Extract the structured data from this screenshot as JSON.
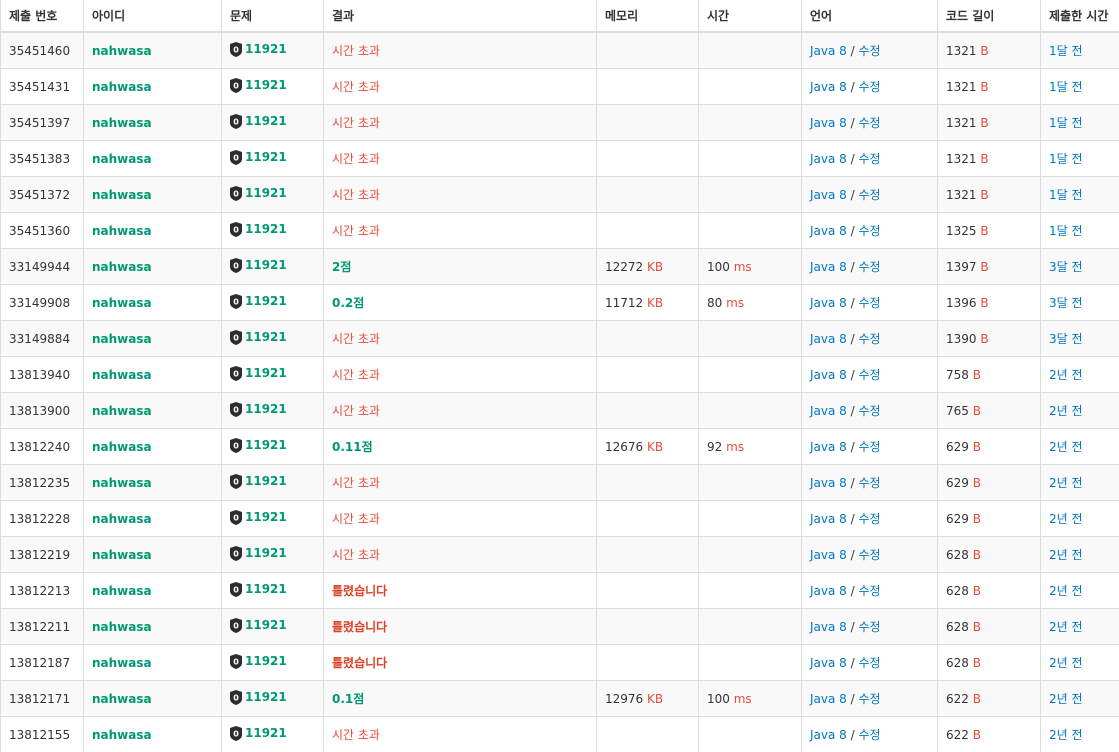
{
  "columns": {
    "id": "제출 번호",
    "user": "아이디",
    "problem": "문제",
    "result": "결과",
    "memory": "메모리",
    "time": "시간",
    "lang": "언어",
    "length": "코드 길이",
    "submitted": "제출한 시간"
  },
  "units": {
    "memory": "KB",
    "time": "ms",
    "length": "B"
  },
  "colors": {
    "user": "#009874",
    "problem": "#009874",
    "time_limit": "#e74c3c",
    "wrong": "#dd4124",
    "partial": "#009874",
    "link": "#0076c0"
  },
  "rows": [
    {
      "id": "35451460",
      "user": "nahwasa",
      "problem": "11921",
      "result": "시간 초과",
      "result_type": "tle",
      "memory": "",
      "time": "",
      "lang": "Java 8",
      "edit": "수정",
      "length": "1321",
      "submitted": "1달 전"
    },
    {
      "id": "35451431",
      "user": "nahwasa",
      "problem": "11921",
      "result": "시간 초과",
      "result_type": "tle",
      "memory": "",
      "time": "",
      "lang": "Java 8",
      "edit": "수정",
      "length": "1321",
      "submitted": "1달 전"
    },
    {
      "id": "35451397",
      "user": "nahwasa",
      "problem": "11921",
      "result": "시간 초과",
      "result_type": "tle",
      "memory": "",
      "time": "",
      "lang": "Java 8",
      "edit": "수정",
      "length": "1321",
      "submitted": "1달 전"
    },
    {
      "id": "35451383",
      "user": "nahwasa",
      "problem": "11921",
      "result": "시간 초과",
      "result_type": "tle",
      "memory": "",
      "time": "",
      "lang": "Java 8",
      "edit": "수정",
      "length": "1321",
      "submitted": "1달 전"
    },
    {
      "id": "35451372",
      "user": "nahwasa",
      "problem": "11921",
      "result": "시간 초과",
      "result_type": "tle",
      "memory": "",
      "time": "",
      "lang": "Java 8",
      "edit": "수정",
      "length": "1321",
      "submitted": "1달 전"
    },
    {
      "id": "35451360",
      "user": "nahwasa",
      "problem": "11921",
      "result": "시간 초과",
      "result_type": "tle",
      "memory": "",
      "time": "",
      "lang": "Java 8",
      "edit": "수정",
      "length": "1325",
      "submitted": "1달 전"
    },
    {
      "id": "33149944",
      "user": "nahwasa",
      "problem": "11921",
      "result": "2점",
      "result_type": "partial",
      "memory": "12272",
      "time": "100",
      "lang": "Java 8",
      "edit": "수정",
      "length": "1397",
      "submitted": "3달 전"
    },
    {
      "id": "33149908",
      "user": "nahwasa",
      "problem": "11921",
      "result": "0.2점",
      "result_type": "partial",
      "memory": "11712",
      "time": "80",
      "lang": "Java 8",
      "edit": "수정",
      "length": "1396",
      "submitted": "3달 전"
    },
    {
      "id": "33149884",
      "user": "nahwasa",
      "problem": "11921",
      "result": "시간 초과",
      "result_type": "tle",
      "memory": "",
      "time": "",
      "lang": "Java 8",
      "edit": "수정",
      "length": "1390",
      "submitted": "3달 전"
    },
    {
      "id": "13813940",
      "user": "nahwasa",
      "problem": "11921",
      "result": "시간 초과",
      "result_type": "tle",
      "memory": "",
      "time": "",
      "lang": "Java 8",
      "edit": "수정",
      "length": "758",
      "submitted": "2년 전"
    },
    {
      "id": "13813900",
      "user": "nahwasa",
      "problem": "11921",
      "result": "시간 초과",
      "result_type": "tle",
      "memory": "",
      "time": "",
      "lang": "Java 8",
      "edit": "수정",
      "length": "765",
      "submitted": "2년 전"
    },
    {
      "id": "13812240",
      "user": "nahwasa",
      "problem": "11921",
      "result": "0.11점",
      "result_type": "partial",
      "memory": "12676",
      "time": "92",
      "lang": "Java 8",
      "edit": "수정",
      "length": "629",
      "submitted": "2년 전"
    },
    {
      "id": "13812235",
      "user": "nahwasa",
      "problem": "11921",
      "result": "시간 초과",
      "result_type": "tle",
      "memory": "",
      "time": "",
      "lang": "Java 8",
      "edit": "수정",
      "length": "629",
      "submitted": "2년 전"
    },
    {
      "id": "13812228",
      "user": "nahwasa",
      "problem": "11921",
      "result": "시간 초과",
      "result_type": "tle",
      "memory": "",
      "time": "",
      "lang": "Java 8",
      "edit": "수정",
      "length": "629",
      "submitted": "2년 전"
    },
    {
      "id": "13812219",
      "user": "nahwasa",
      "problem": "11921",
      "result": "시간 초과",
      "result_type": "tle",
      "memory": "",
      "time": "",
      "lang": "Java 8",
      "edit": "수정",
      "length": "628",
      "submitted": "2년 전"
    },
    {
      "id": "13812213",
      "user": "nahwasa",
      "problem": "11921",
      "result": "틀렸습니다",
      "result_type": "wa",
      "memory": "",
      "time": "",
      "lang": "Java 8",
      "edit": "수정",
      "length": "628",
      "submitted": "2년 전"
    },
    {
      "id": "13812211",
      "user": "nahwasa",
      "problem": "11921",
      "result": "틀렸습니다",
      "result_type": "wa",
      "memory": "",
      "time": "",
      "lang": "Java 8",
      "edit": "수정",
      "length": "628",
      "submitted": "2년 전"
    },
    {
      "id": "13812187",
      "user": "nahwasa",
      "problem": "11921",
      "result": "틀렸습니다",
      "result_type": "wa",
      "memory": "",
      "time": "",
      "lang": "Java 8",
      "edit": "수정",
      "length": "628",
      "submitted": "2년 전"
    },
    {
      "id": "13812171",
      "user": "nahwasa",
      "problem": "11921",
      "result": "0.1점",
      "result_type": "partial",
      "memory": "12976",
      "time": "100",
      "lang": "Java 8",
      "edit": "수정",
      "length": "622",
      "submitted": "2년 전"
    },
    {
      "id": "13812155",
      "user": "nahwasa",
      "problem": "11921",
      "result": "시간 초과",
      "result_type": "tle",
      "memory": "",
      "time": "",
      "lang": "Java 8",
      "edit": "수정",
      "length": "622",
      "submitted": "2년 전"
    }
  ]
}
